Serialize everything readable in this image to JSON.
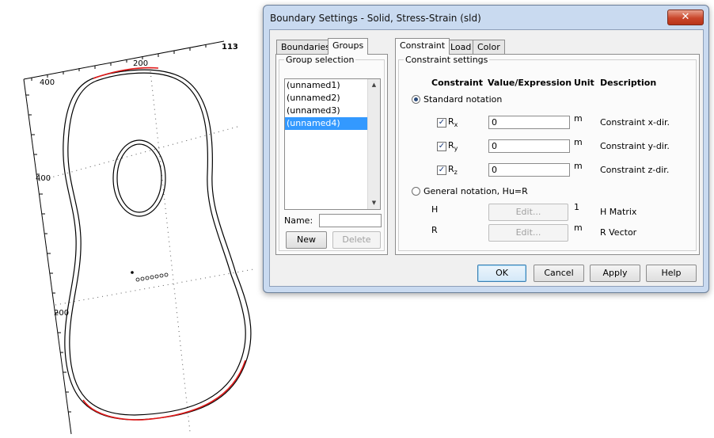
{
  "canvas": {
    "axis_labels": [
      "113",
      "200",
      "400",
      "400",
      "200"
    ]
  },
  "dialog": {
    "title": "Boundary Settings - Solid, Stress-Strain (sld)",
    "close_symbol": "✕",
    "left_tabs": [
      "Boundaries",
      "Groups"
    ],
    "active_left_tab": "Groups",
    "group_selection_label": "Group selection",
    "groups": [
      "(unnamed1)",
      "(unnamed2)",
      "(unnamed3)",
      "(unnamed4)"
    ],
    "selected_group": "(unnamed4)",
    "name_label": "Name:",
    "name_value": "",
    "new_button": "New",
    "delete_button": "Delete",
    "right_tabs": [
      "Constraint",
      "Load",
      "Color"
    ],
    "active_right_tab": "Constraint",
    "constraint_settings_label": "Constraint settings",
    "headers": {
      "constraint": "Constraint",
      "value": "Value/Expression",
      "unit": "Unit",
      "description": "Description"
    },
    "standard_notation_label": "Standard notation",
    "rows": [
      {
        "symbol": "R",
        "subscript": "x",
        "checked": true,
        "value": "0",
        "unit": "m",
        "description": "Constraint x-dir."
      },
      {
        "symbol": "R",
        "subscript": "y",
        "checked": true,
        "value": "0",
        "unit": "m",
        "description": "Constraint y-dir."
      },
      {
        "symbol": "R",
        "subscript": "z",
        "checked": true,
        "value": "0",
        "unit": "m",
        "description": "Constraint z-dir."
      }
    ],
    "general_notation_label": "General notation, Hu=R",
    "general_rows": [
      {
        "symbol": "H",
        "button": "Edit...",
        "unit": "1",
        "description": "H Matrix"
      },
      {
        "symbol": "R",
        "button": "Edit...",
        "unit": "m",
        "description": "R Vector"
      }
    ],
    "buttons": {
      "ok": "OK",
      "cancel": "Cancel",
      "apply": "Apply",
      "help": "Help"
    },
    "colors": {
      "selection": "#3399ff",
      "highlight_edge": "#e01818"
    }
  }
}
